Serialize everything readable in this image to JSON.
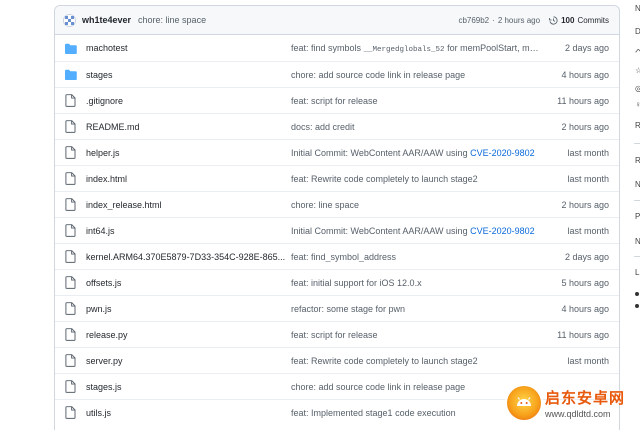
{
  "commit_header": {
    "author": "wh1te4ever",
    "message": "chore: line space",
    "sha": "cb769b2",
    "separator": "·",
    "time": "2 hours ago",
    "commits_count": "100",
    "commits_label": "Commits"
  },
  "files": [
    {
      "type": "folder",
      "name": "machotest",
      "msg_parts": [
        {
          "t": "feat: find symbols "
        },
        {
          "t": "__Mergedglobals_52",
          "mono": true
        },
        {
          "t": " for memPoolStart, me..."
        }
      ],
      "age": "2 days ago"
    },
    {
      "type": "folder",
      "name": "stages",
      "msg_parts": [
        {
          "t": "chore: add source code link in release page"
        }
      ],
      "age": "4 hours ago"
    },
    {
      "type": "file",
      "name": ".gitignore",
      "msg_parts": [
        {
          "t": "feat: script for release"
        }
      ],
      "age": "11 hours ago"
    },
    {
      "type": "file",
      "name": "README.md",
      "msg_parts": [
        {
          "t": "docs: add credit"
        }
      ],
      "age": "2 hours ago"
    },
    {
      "type": "file",
      "name": "helper.js",
      "msg_parts": [
        {
          "t": "Initial Commit: WebContent AAR/AAW using "
        },
        {
          "t": "CVE-2020-9802",
          "link": true
        }
      ],
      "age": "last month"
    },
    {
      "type": "file",
      "name": "index.html",
      "msg_parts": [
        {
          "t": "feat: Rewrite code completely to launch stage2"
        }
      ],
      "age": "last month"
    },
    {
      "type": "file",
      "name": "index_release.html",
      "msg_parts": [
        {
          "t": "chore: line space"
        }
      ],
      "age": "2 hours ago"
    },
    {
      "type": "file",
      "name": "int64.js",
      "msg_parts": [
        {
          "t": "Initial Commit: WebContent AAR/AAW using "
        },
        {
          "t": "CVE-2020-9802",
          "link": true
        }
      ],
      "age": "last month"
    },
    {
      "type": "file",
      "name": "kernel.ARM64.370E5879-7D33-354C-928E-865...",
      "msg_parts": [
        {
          "t": "feat: find_symbol_address"
        }
      ],
      "age": "2 days ago"
    },
    {
      "type": "file",
      "name": "offsets.js",
      "msg_parts": [
        {
          "t": "feat: initial support for iOS 12.0.x"
        }
      ],
      "age": "5 hours ago"
    },
    {
      "type": "file",
      "name": "pwn.js",
      "msg_parts": [
        {
          "t": "refactor: some stage for pwn"
        }
      ],
      "age": "4 hours ago"
    },
    {
      "type": "file",
      "name": "release.py",
      "msg_parts": [
        {
          "t": "feat: script for release"
        }
      ],
      "age": "11 hours ago"
    },
    {
      "type": "file",
      "name": "server.py",
      "msg_parts": [
        {
          "t": "feat: Rewrite code completely to launch stage2"
        }
      ],
      "age": "last month"
    },
    {
      "type": "file",
      "name": "stages.js",
      "msg_parts": [
        {
          "t": "chore: add source code link in release page"
        }
      ],
      "age": ""
    },
    {
      "type": "file",
      "name": "utils.js",
      "msg_parts": [
        {
          "t": "feat: Implemented stage1 code execution"
        }
      ],
      "age": ""
    }
  ],
  "right_column_fragments": [
    "N",
    "D",
    "ペ",
    "☆",
    "◎",
    "♀",
    "R",
    "R",
    "N",
    "P",
    "N",
    "L"
  ],
  "watermark": {
    "cn_text": "启东安卓网",
    "url": "www.qdldtd.com"
  },
  "colors": {
    "folder": "#54aeff",
    "link": "#0969da",
    "muted": "#57606a",
    "border": "#d0d7de",
    "header_bg": "#f6f8fa"
  }
}
